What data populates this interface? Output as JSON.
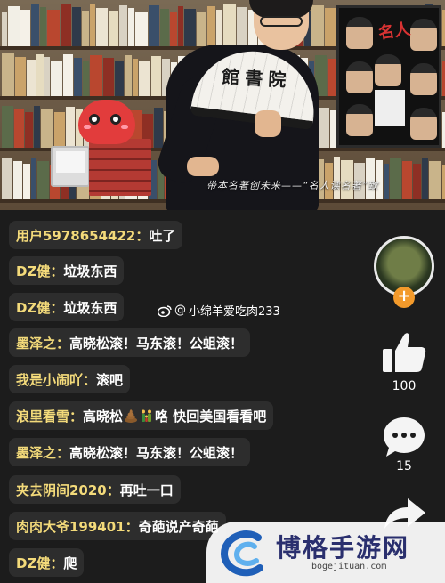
{
  "video": {
    "fan_text": "館書院",
    "poster_text": "名人",
    "caption": "带本名著创未来——“名人读名著”致"
  },
  "watermark_overlay": {
    "prefix": "@",
    "handle": "小绵羊爱吃肉233"
  },
  "comments": [
    {
      "user": "用户5978654422：",
      "text": "吐了"
    },
    {
      "user": "DZ健：",
      "text": "垃圾东西"
    },
    {
      "user": "DZ健：",
      "text": "垃圾东西"
    },
    {
      "user": "墨泽之：",
      "text": "高晓松滚！马东滚！公蛆滚！"
    },
    {
      "user": "我是小闹吖：",
      "text": "滚吧"
    },
    {
      "user": "浪里看雪：",
      "text_a": "高晓松",
      "emojis": [
        "poop-emoji",
        "family-emoji"
      ],
      "text_b": "咯 快回美国看看吧"
    },
    {
      "user": "墨泽之：",
      "text": "高晓松滚！马东滚！公蛆滚！"
    },
    {
      "user": "夹去阴间2020：",
      "text": "再吐一口"
    },
    {
      "user": "肉肉大爷199401：",
      "text": "奇葩说产奇葩"
    },
    {
      "user": "DZ健：",
      "text": "爬"
    }
  ],
  "rail": {
    "follow_symbol": "+",
    "like_count": "100",
    "comment_count": "15",
    "icons": [
      "avatar",
      "follow-plus-icon",
      "thumbs-up-icon",
      "comment-bubble-icon",
      "share-arrow-icon"
    ]
  },
  "site_watermark": {
    "title": "博格手游网",
    "url": "bogejituan.com"
  },
  "colors": {
    "username": "#f3da7a",
    "follow_badge": "#f39a2b",
    "chat_bg": "#1c1c1c",
    "watermark_title": "#2a2f6e"
  }
}
